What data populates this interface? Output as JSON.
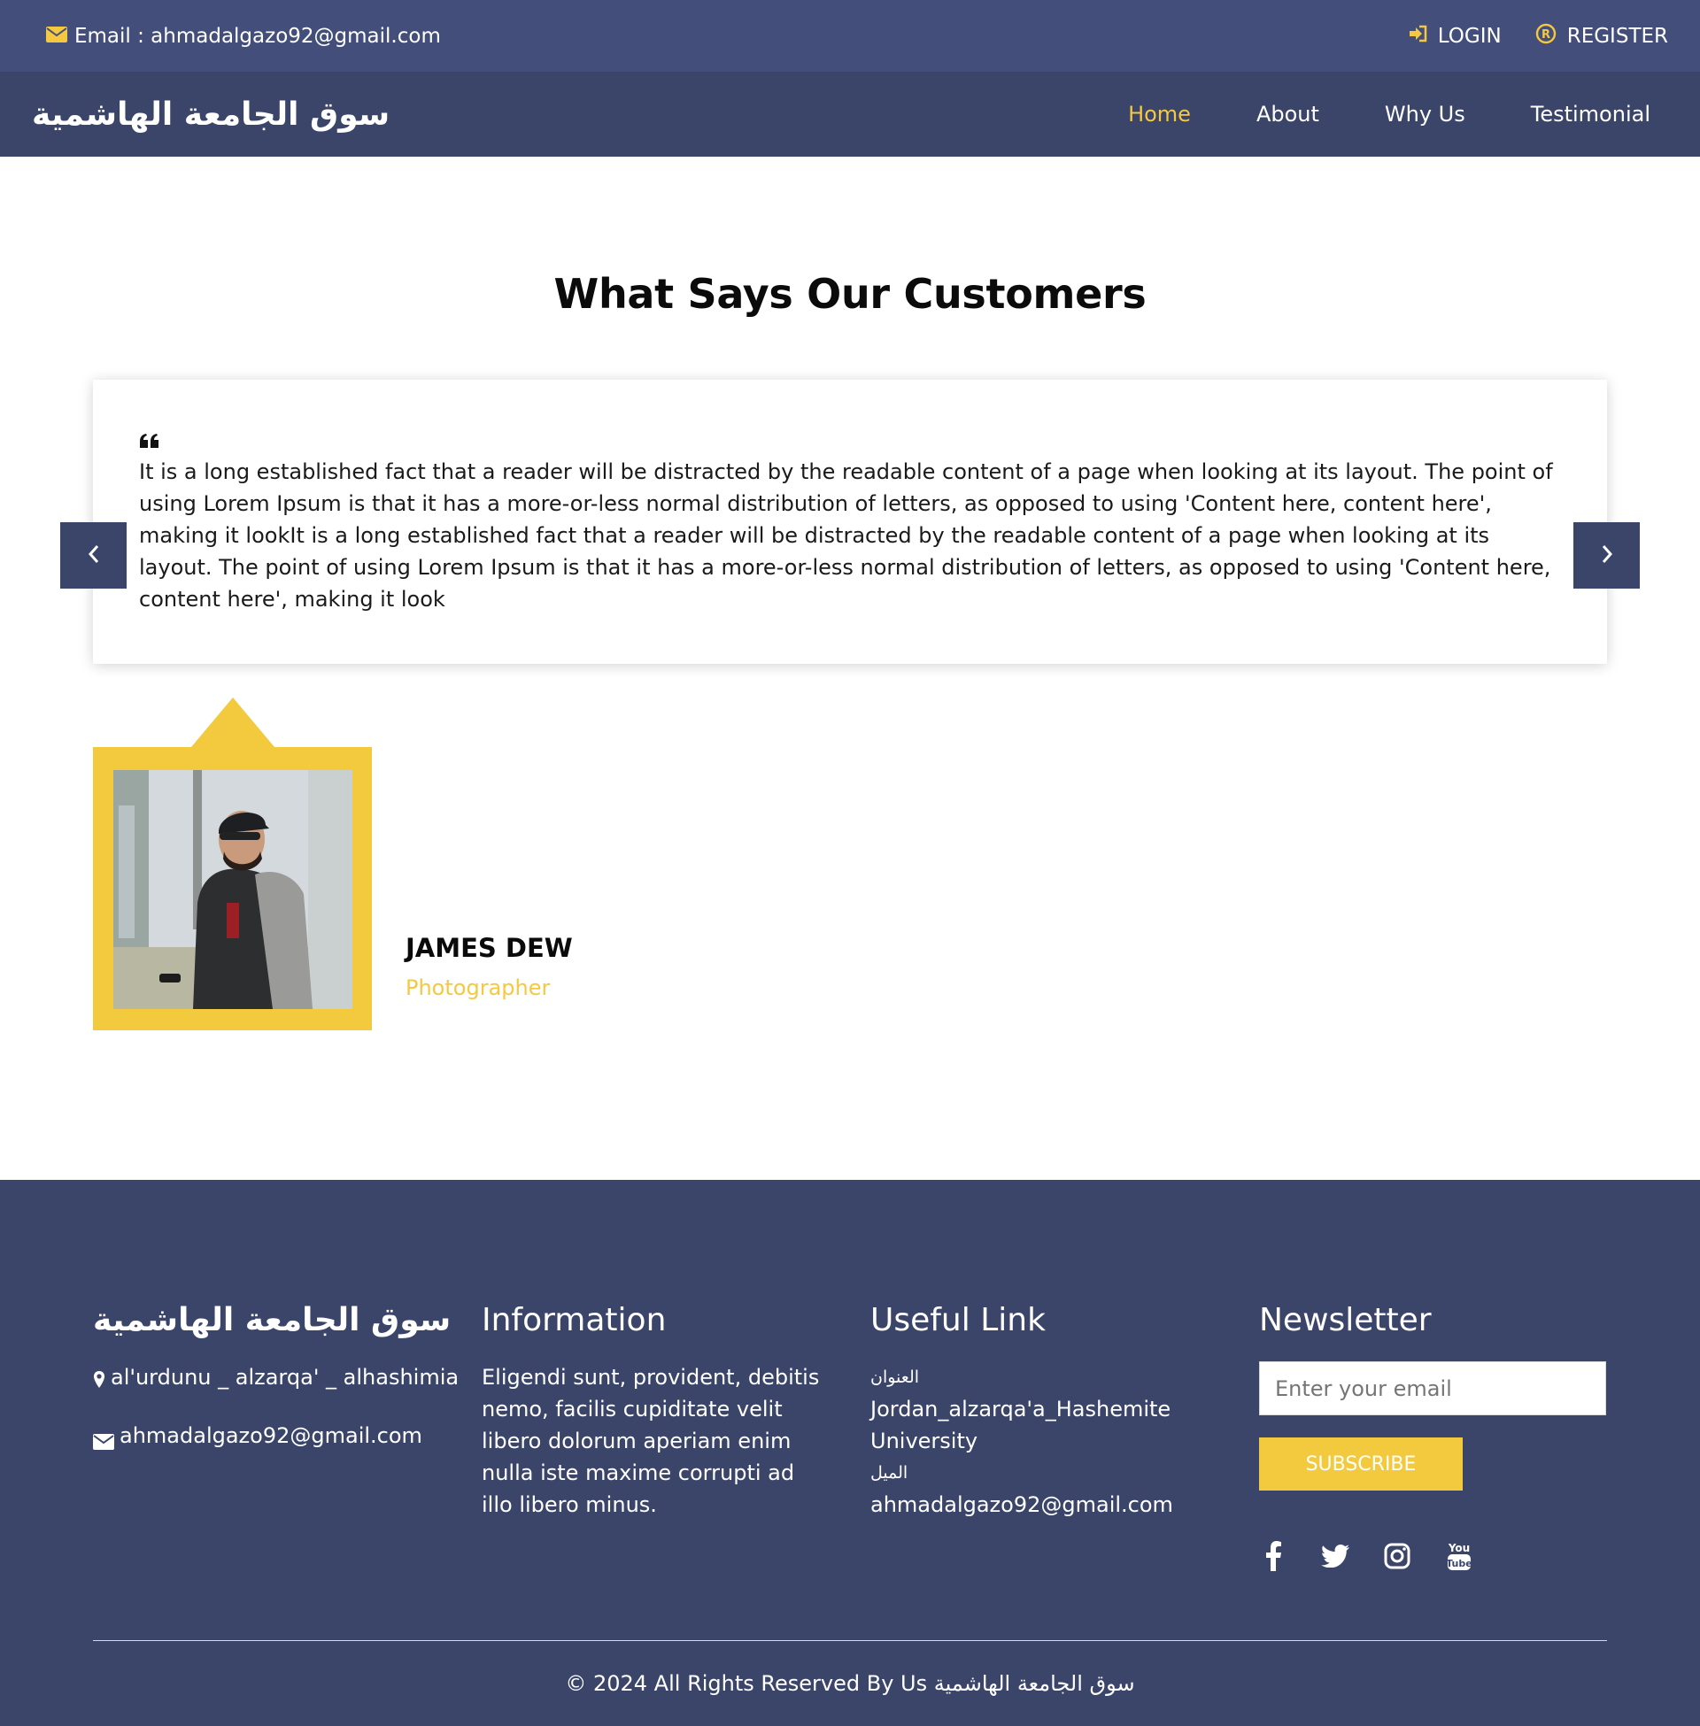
{
  "topbar": {
    "email": "Email : ahmadalgazo92@gmail.com",
    "login": "LOGIN",
    "register": "REGISTER"
  },
  "navbar": {
    "brand": "سوق الجامعة الهاشمية",
    "items": [
      {
        "label": "Home",
        "active": true
      },
      {
        "label": "About",
        "active": false
      },
      {
        "label": "Why Us",
        "active": false
      },
      {
        "label": "Testimonial",
        "active": false
      }
    ]
  },
  "testimonial": {
    "title": "What Says Our Customers",
    "quote": "It is a long established fact that a reader will be distracted by the readable content of a page when looking at its layout. The point of using Lorem Ipsum is that it has a more-or-less normal distribution of letters, as opposed to using 'Content here, content here', making it lookIt is a long established fact that a reader will be distracted by the readable content of a page when looking at its layout. The point of using Lorem Ipsum is that it has a more-or-less normal distribution of letters, as opposed to using 'Content here, content here', making it look",
    "client_name": "JAMES DEW",
    "client_role": "Photographer"
  },
  "footer": {
    "brand": "سوق الجامعة الهاشمية",
    "address": "al'urdunu _ alzarqa' _ alhashimia",
    "email": "ahmadalgazo92@gmail.com",
    "info_title": "Information",
    "info_text": "Eligendi sunt, provident, debitis nemo, facilis cupiditate velit libero dolorum aperiam enim nulla iste maxime corrupti ad illo libero minus.",
    "links_title": "Useful Link",
    "address_label": "العنوان",
    "address_value": "Jordan_alzarqa'a_Hashemite University",
    "mail_label": "الميل",
    "mail_value": "ahmadalgazo92@gmail.com",
    "newsletter_title": "Newsletter",
    "newsletter_placeholder": "Enter your email",
    "subscribe": "SUBSCRIBE",
    "socials": [
      "facebook-icon",
      "twitter-icon",
      "instagram-icon",
      "youtube-icon"
    ],
    "copyright": "© 2024 All Rights Reserved By Us سوق الجامعة الهاشمية"
  },
  "colors": {
    "topbar": "#434f7a",
    "navbar": "#3b4569",
    "accent": "#f5c842",
    "footer": "#3b4569"
  }
}
